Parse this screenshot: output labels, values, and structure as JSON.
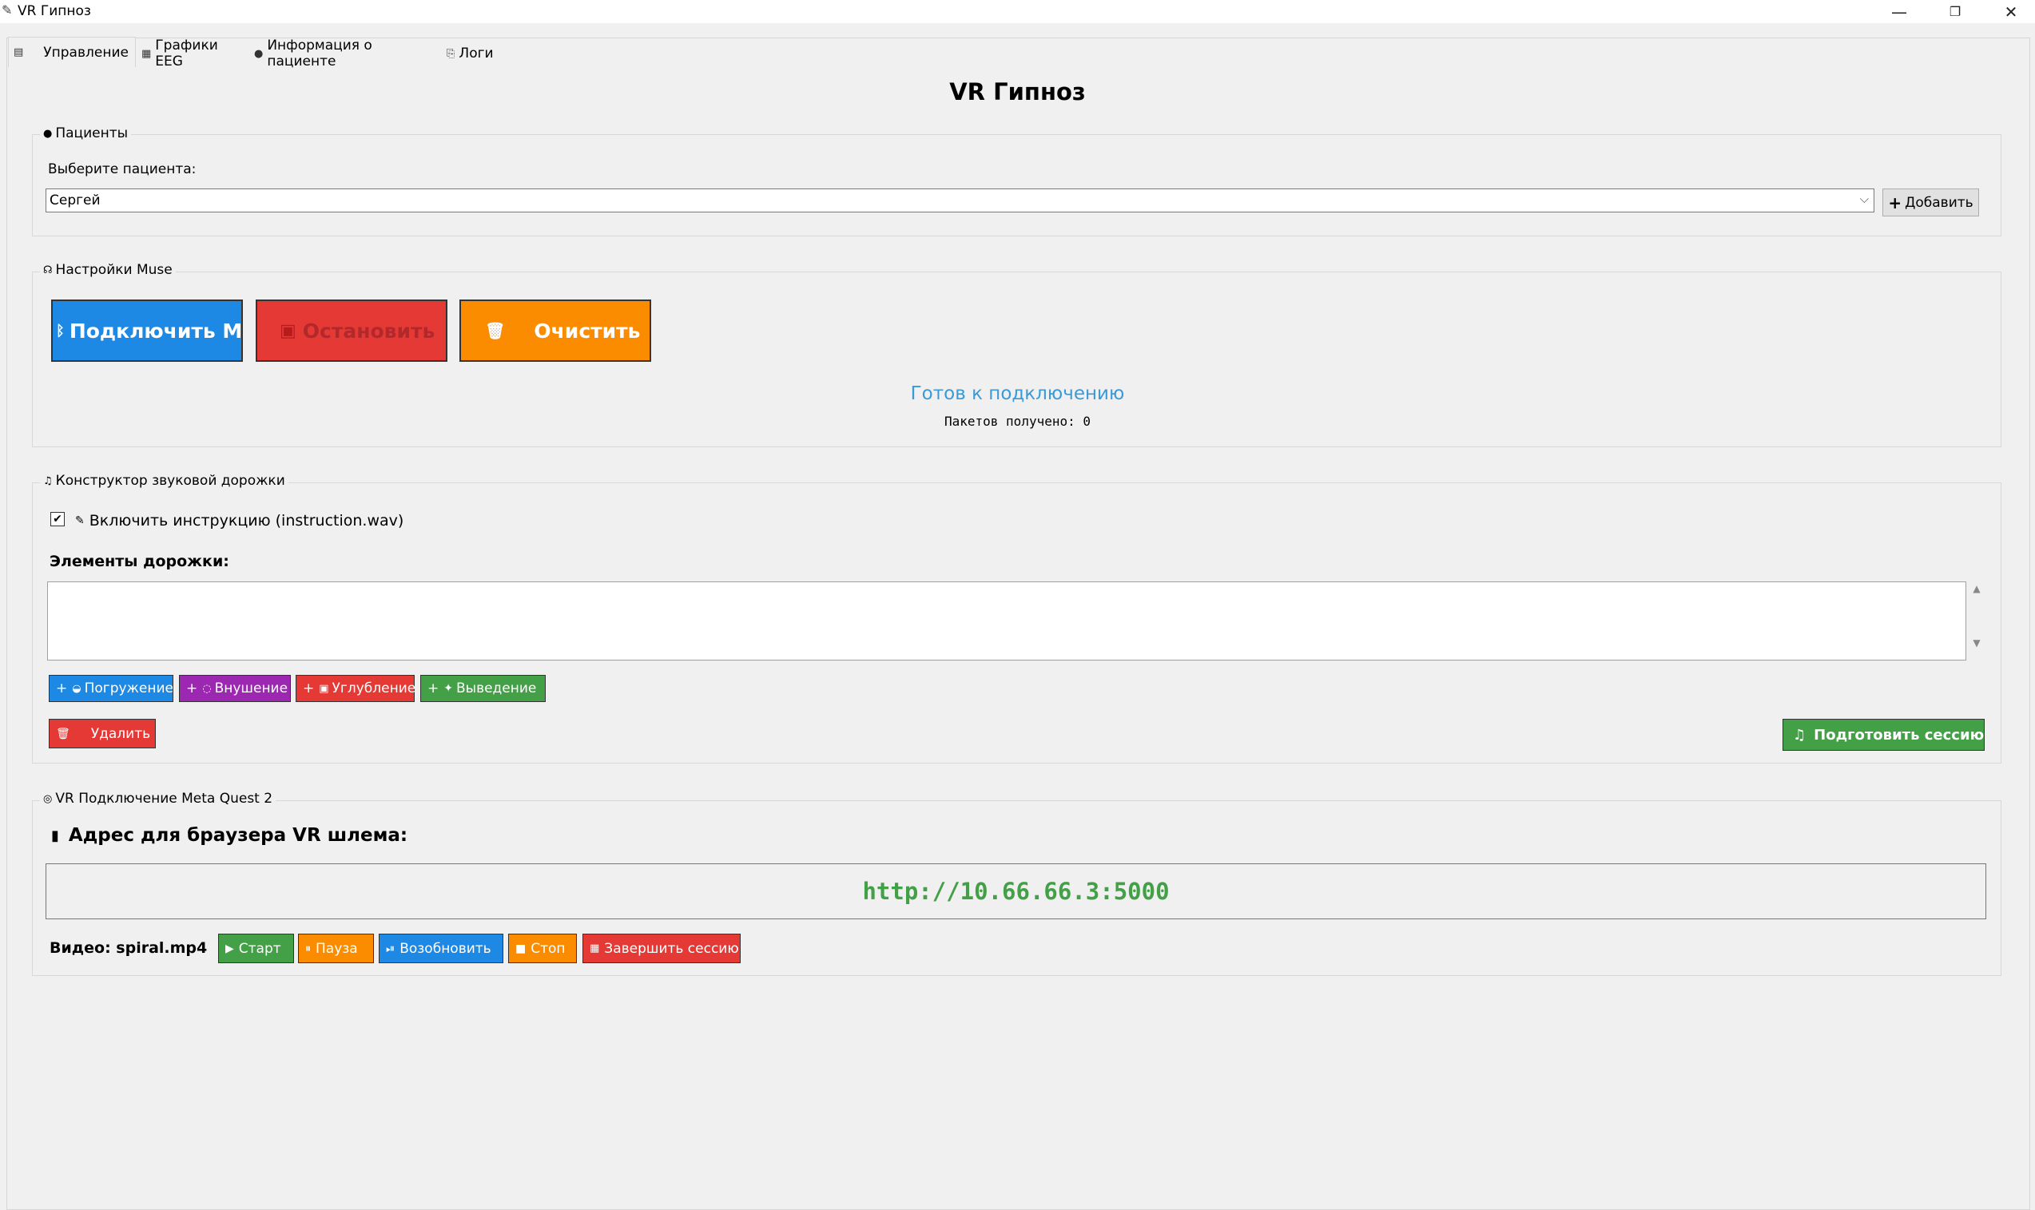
{
  "window": {
    "title": "VR Гипноз",
    "icons": {
      "app": "feather-icon",
      "minimize": "minimize-icon",
      "restore": "restore-icon",
      "close": "close-icon"
    }
  },
  "tabs": [
    {
      "label": "Управление",
      "icon": "panel-icon"
    },
    {
      "label": "Графики EEG",
      "icon": "chart-icon"
    },
    {
      "label": "Информация о пациенте",
      "icon": "person-icon"
    },
    {
      "label": "Логи",
      "icon": "document-icon"
    }
  ],
  "heading": "VR Гипноз",
  "patients": {
    "group_label": "Пациенты",
    "select_label": "Выберите пациента:",
    "selected": "Сергей",
    "add_label": "Добавить"
  },
  "muse": {
    "group_label": "Настройки Muse",
    "connect_label": "Подключить Muse",
    "stop_label": "Остановить",
    "clear_label": "Очистить",
    "status_text": "Готов к подключению",
    "packets_text": "Пакетов получено: 0",
    "colors": {
      "connect": "#1e88e5",
      "stop": "#e53935",
      "clear": "#fb8c00",
      "status": "#3a9ad9"
    }
  },
  "track": {
    "group_label": "Конструктор звуковой дорожки",
    "include_label": "Включить инструкцию (instruction.wav)",
    "include_checked": true,
    "elements_label": "Элементы дорожки:",
    "add_buttons": [
      {
        "label": "Погружение",
        "color": "#1e88e5"
      },
      {
        "label": "Внушение",
        "color": "#9c27b0"
      },
      {
        "label": "Углубление",
        "color": "#e53935"
      },
      {
        "label": "Выведение",
        "color": "#43a047"
      }
    ],
    "delete_label": "Удалить",
    "prepare_label": "Подготовить сессию"
  },
  "vr": {
    "group_label": "VR Подключение Meta Quest 2",
    "address_label": "Адрес для браузера VR шлема:",
    "url": "http://10.66.66.3:5000",
    "url_color": "#43a047",
    "video_label": "Видео: spiral.mp4",
    "controls": [
      {
        "label": "Старт",
        "color": "#43a047"
      },
      {
        "label": "Пауза",
        "color": "#fb8c00"
      },
      {
        "label": "Возобновить",
        "color": "#1e88e5"
      },
      {
        "label": "Стоп",
        "color": "#fb8c00"
      },
      {
        "label": "Завершить сессию",
        "color": "#e53935"
      }
    ]
  }
}
